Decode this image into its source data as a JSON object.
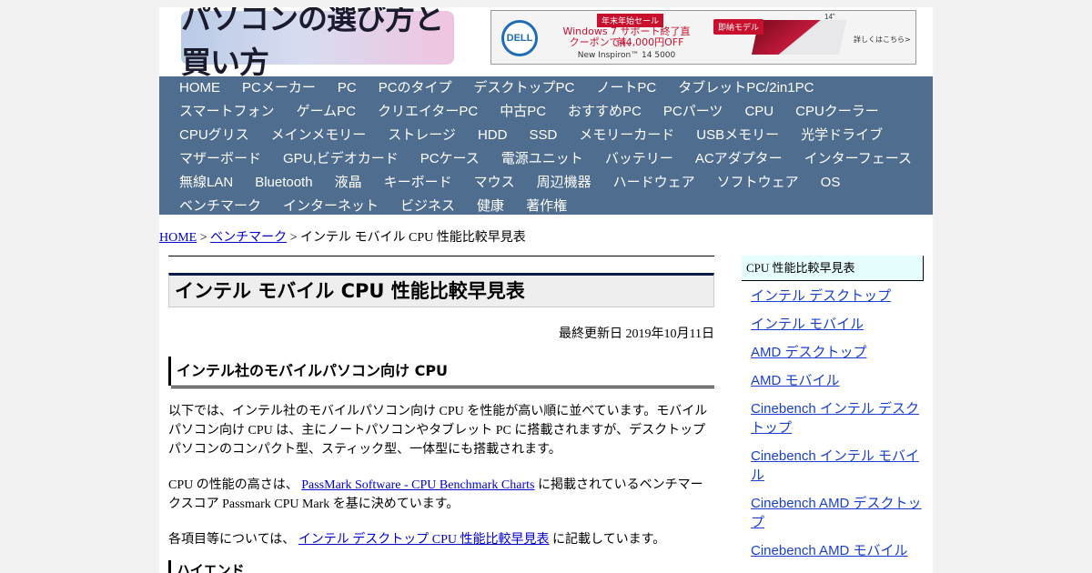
{
  "header": {
    "logo_text": "パソコンの選び方と買い方",
    "ad": {
      "brand": "DELL",
      "tag": "年末年始セール",
      "line1": "Windows 7 サポート終了直前、",
      "line2": "クーポンで44,000円OFF",
      "model": "New Inspiron™ 14 5000",
      "badge": "即納モデル",
      "size": "14\"",
      "cta": "詳しくはこちら>"
    }
  },
  "nav": {
    "items": [
      "HOME",
      "PCメーカー",
      "PC",
      "PCのタイプ",
      "デスクトップPC",
      "ノートPC",
      "タブレットPC/2in1PC",
      "スマートフォン",
      "ゲームPC",
      "クリエイターPC",
      "中古PC",
      "おすすめPC",
      "PCパーツ",
      "CPU",
      "CPUクーラー",
      "CPUグリス",
      "メインメモリー",
      "ストレージ",
      "HDD",
      "SSD",
      "メモリーカード",
      "USBメモリー",
      "光学ドライブ",
      "マザーボード",
      "GPU,ビデオカード",
      "PCケース",
      "電源ユニット",
      "バッテリー",
      "ACアダプター",
      "インターフェース",
      "無線LAN",
      "Bluetooth",
      "液晶",
      "キーボード",
      "マウス",
      "周辺機器",
      "ハードウェア",
      "ソフトウェア",
      "OS",
      "ベンチマーク",
      "インターネット",
      "ビジネス",
      "健康",
      "著作権"
    ]
  },
  "breadcrumb": {
    "home": "HOME",
    "sep1": " > ",
    "bench": "ベンチマーク",
    "sep2": " > ",
    "current": "インテル モバイル CPU 性能比較早見表"
  },
  "main": {
    "title": "インテル モバイル CPU 性能比較早見表",
    "updated": "最終更新日 2019年10月11日",
    "h2": "インテル社のモバイルパソコン向け CPU",
    "p1": "以下では、インテル社のモバイルパソコン向け CPU を性能が高い順に並べています。モバイルパソコン向け CPU は、主にノートパソコンやタブレット PC に搭載されますが、デスクトップパソコンのコンパクト型、スティック型、一体型にも搭載されます。",
    "p2_pre": "CPU の性能の高さは、",
    "p2_link": "PassMark Software - CPU Benchmark Charts",
    "p2_post": " に掲載されているベンチマークスコア Passmark CPU Mark を基に決めています。",
    "p3_pre": "各項目等については、",
    "p3_link": "インテル デスクトップ CPU 性能比較早見表",
    "p3_post": " に記載しています。",
    "h3": "ハイエンド"
  },
  "sidebar": {
    "heading": "CPU 性能比較早見表",
    "links": [
      "インテル デスクトップ",
      "インテル モバイル",
      "AMD デスクトップ",
      "AMD モバイル",
      "Cinebench インテル デスクトップ",
      "Cinebench インテル モバイル",
      "Cinebench AMD デスクトップ",
      "Cinebench AMD モバイル"
    ]
  }
}
